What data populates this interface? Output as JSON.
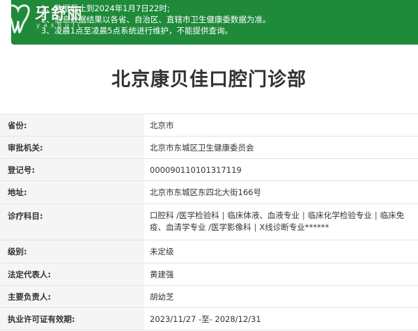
{
  "notice": {
    "lines": [
      "1、数据截止到2024年1月7日22时;",
      "2、信息数据结果以各省、自治区、直辖市卫生健康委数据为准。",
      "3、凌晨1点至凌晨5点系统进行维护，不能提供查询。"
    ],
    "color": "#1f8a3a"
  },
  "watermark": {
    "text": "牙舒丽",
    "sub": "yashuli"
  },
  "page_title": "北京康贝佳口腔门诊部",
  "rows": [
    {
      "label": "省份:",
      "value": "北京市"
    },
    {
      "label": "审批机关:",
      "value": "北京市东城区卫生健康委员会"
    },
    {
      "label": "登记号:",
      "value": "000090110101317119"
    },
    {
      "label": "地址:",
      "value": "北京市东城区东四北大街166号"
    },
    {
      "label": "诊疗科目:",
      "value": ""
    },
    {
      "label": "级别:",
      "value": "未定级"
    },
    {
      "label": "法定代表人:",
      "value": "黄建强"
    },
    {
      "label": "主要负责人:",
      "value": "胡幼芝"
    },
    {
      "label": "执业许可证有效期:",
      "value": "2023/11/27 -至- 2028/12/31"
    }
  ],
  "departments": [
    "口腔科 /医学检验科",
    "临床体液、血液专业",
    "临床化学检验专业",
    "临床免疫、血清学专业 /医学影像科",
    "X线诊断专业******"
  ]
}
